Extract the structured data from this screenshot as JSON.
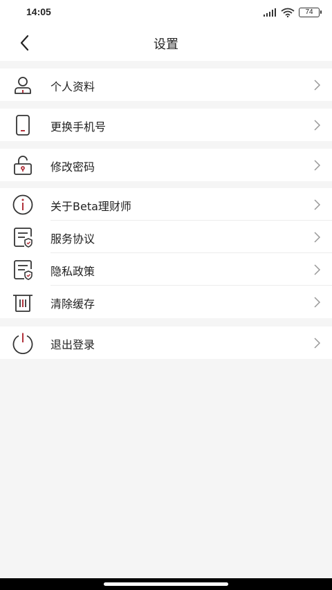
{
  "status": {
    "time": "14:05",
    "battery": "74"
  },
  "header": {
    "title": "设置"
  },
  "groups": [
    {
      "items": [
        {
          "label": "个人资料",
          "icon": "profile-icon"
        }
      ]
    },
    {
      "items": [
        {
          "label": "更换手机号",
          "icon": "phone-icon"
        }
      ]
    },
    {
      "items": [
        {
          "label": "修改密码",
          "icon": "lock-icon"
        }
      ]
    },
    {
      "items": [
        {
          "label": "关于Beta理财师",
          "icon": "info-icon"
        },
        {
          "label": "服务协议",
          "icon": "document-shield-icon"
        },
        {
          "label": "隐私政策",
          "icon": "document-shield-icon"
        },
        {
          "label": "清除缓存",
          "icon": "trash-icon"
        }
      ]
    },
    {
      "items": [
        {
          "label": "退出登录",
          "icon": "power-icon"
        }
      ]
    }
  ],
  "colors": {
    "accent": "#b0303a",
    "icon_stroke": "#333333",
    "background": "#f5f5f5"
  }
}
